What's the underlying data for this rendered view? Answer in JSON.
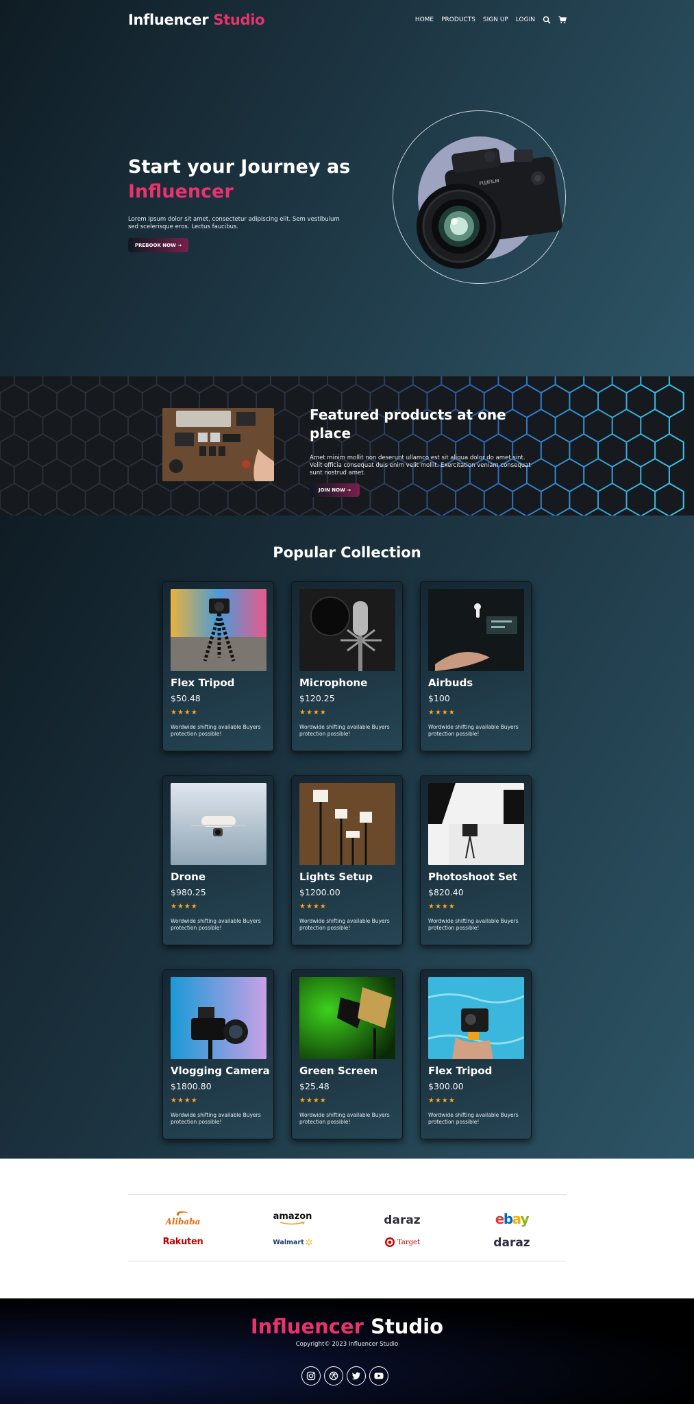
{
  "brand": {
    "name_part1": "Influencer",
    "name_part2": "Studio"
  },
  "nav": {
    "links": [
      "HOME",
      "PRODUCTS",
      "SIGN UP",
      "LOGIN"
    ],
    "icons": [
      "search-icon",
      "cart-icon"
    ]
  },
  "hero": {
    "title_line1": "Start your Journey as",
    "title_line2": "Influencer",
    "subtitle": "Lorem ipsum dolor sit amet, consectetur adipiscing elit. Sem vestibulum sed scelerisque eros. Lectus faucibus.",
    "button": "PREBOOK NOW →",
    "image": "camera-photo"
  },
  "featured": {
    "title": "Featured products at one place",
    "text": "Amet minim mollit non deserunt ullamco est sit aliqua dolor do amet sint. Velit officia consequat duis enim velit mollit. Exercitation veniam consequat sunt nostrud amet.",
    "button": "JOIN NOW →",
    "image": "gear-flatlay-photo"
  },
  "popular": {
    "title": "Popular Collection",
    "rating_stars": "★★★★",
    "description": "Wordwide shifting available Buyers protection possible!",
    "products": [
      {
        "name": "Flex Tripod",
        "price": "$50.48",
        "image": "tripod-photo"
      },
      {
        "name": "Microphone",
        "price": "$120.25",
        "image": "microphone-photo"
      },
      {
        "name": "Airbuds",
        "price": "$100",
        "image": "airbuds-photo"
      },
      {
        "name": "Drone",
        "price": "$980.25",
        "image": "drone-photo"
      },
      {
        "name": "Lights Setup",
        "price": "$1200.00",
        "image": "lights-photo"
      },
      {
        "name": "Photoshoot Set",
        "price": "$820.40",
        "image": "photoshoot-photo"
      },
      {
        "name": "Vlogging Camera",
        "price": "$1800.80",
        "image": "vlog-camera-photo"
      },
      {
        "name": "Green Screen",
        "price": "$25.48",
        "image": "green-screen-photo"
      },
      {
        "name": "Flex Tripod",
        "price": "$300.00",
        "image": "action-camera-photo"
      }
    ]
  },
  "partners": {
    "alibaba": "Alibaba",
    "amazon": "amazon",
    "daraz": "daraz",
    "ebay_e": "e",
    "ebay_b": "b",
    "ebay_a": "a",
    "ebay_y": "y",
    "rakuten": "Rakuten",
    "walmart": "Walmart",
    "target": "Target",
    "colors": {
      "alibaba": "#e36c0a",
      "amazon": "#111111",
      "daraz": "#2f2f3e",
      "rakuten": "#bf0000",
      "target": "#cc0000"
    }
  },
  "footer": {
    "logo_part1": "Influencer",
    "logo_part2": "Studio",
    "copyright": "Copyright© 2023 Influencer Studio",
    "social": [
      "instagram-icon",
      "dribbble-icon",
      "twitter-icon",
      "youtube-icon"
    ]
  },
  "colors": {
    "accent": "#e8336d",
    "star": "#f6a623",
    "card_bg": "#1d3542"
  }
}
